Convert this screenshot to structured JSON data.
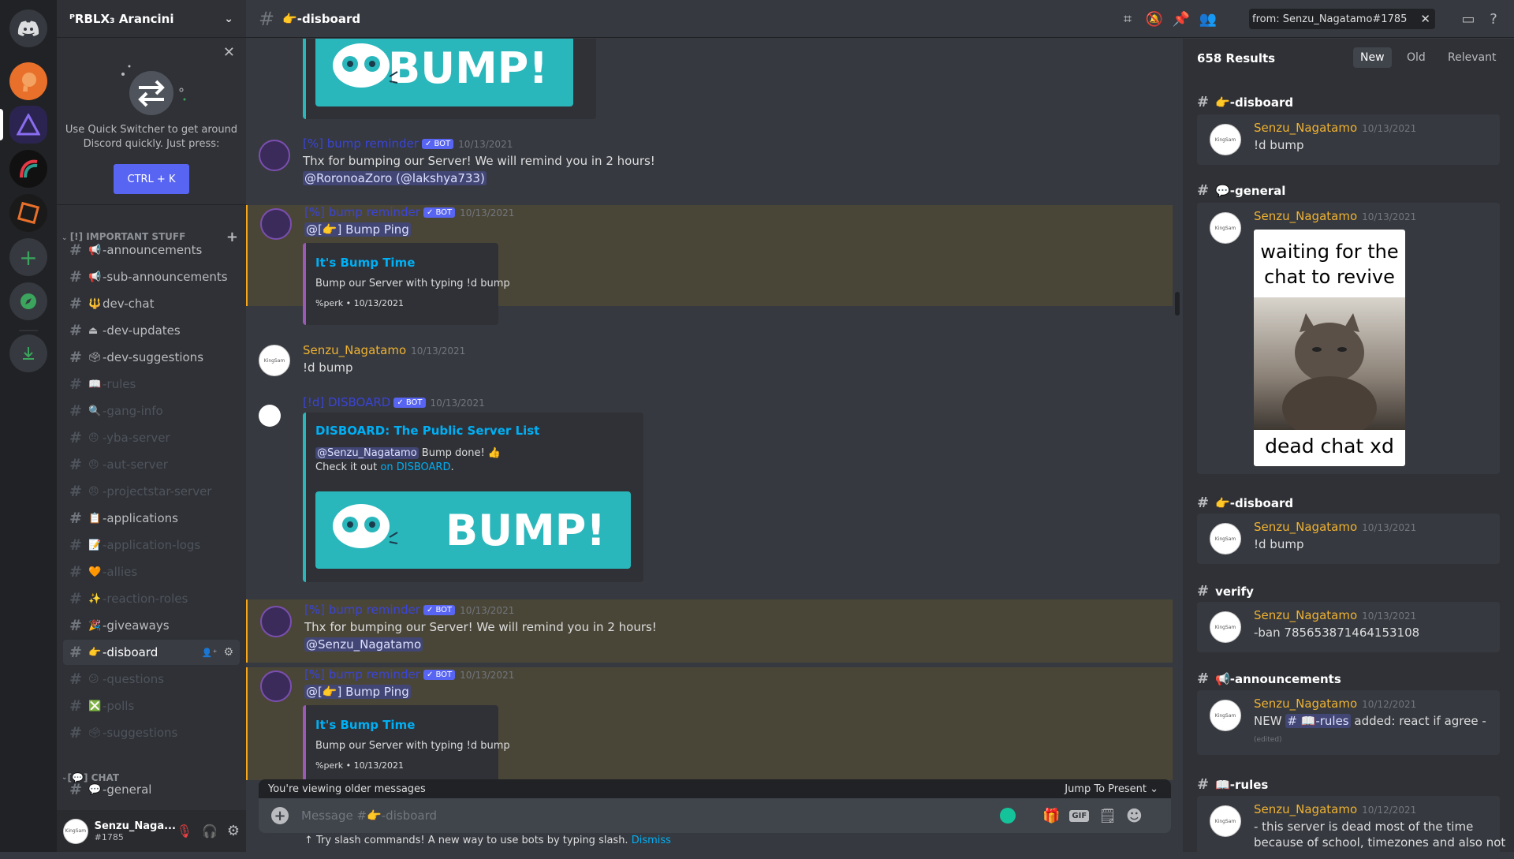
{
  "server": {
    "name": "ᴾRBLX₃ Arancini"
  },
  "quick_switcher": {
    "text": "Use Quick Switcher to get around Discord quickly. Just press:",
    "button": "CTRL + K"
  },
  "categories": [
    {
      "label": "[!] IMPORTANT STUFF"
    },
    {
      "label": "[💬] CHAT"
    }
  ],
  "channels": [
    {
      "icon": "📢",
      "name": "-announcements",
      "muted": false
    },
    {
      "icon": "📢",
      "name": "-sub-announcements",
      "muted": false
    },
    {
      "icon": "🔱",
      "name": "dev-chat",
      "muted": false
    },
    {
      "icon": "⏏",
      "name": "-dev-updates",
      "muted": false
    },
    {
      "icon": "🗳",
      "name": "-dev-suggestions",
      "muted": false
    },
    {
      "icon": "📖",
      "name": "-rules",
      "muted": true
    },
    {
      "icon": "🔍",
      "name": "-gang-info",
      "muted": true
    },
    {
      "icon": "😠",
      "name": "-yba-server",
      "muted": true
    },
    {
      "icon": "😠",
      "name": "-aut-server",
      "muted": true
    },
    {
      "icon": "😠",
      "name": "-projectstar-server",
      "muted": true
    },
    {
      "icon": "📋",
      "name": "-applications",
      "muted": false
    },
    {
      "icon": "📝",
      "name": "-application-logs",
      "muted": true
    },
    {
      "icon": "🧡",
      "name": "-allies",
      "muted": true
    },
    {
      "icon": "✨",
      "name": "-reaction-roles",
      "muted": true
    },
    {
      "icon": "🎉",
      "name": "-giveaways",
      "muted": false
    },
    {
      "icon": "👉",
      "name": "-disboard",
      "muted": false,
      "active": true
    },
    {
      "icon": "😕",
      "name": "-questions",
      "muted": true
    },
    {
      "icon": "❎",
      "name": "-polls",
      "muted": true
    },
    {
      "icon": "🗳",
      "name": "-suggestions",
      "muted": true
    },
    {
      "icon": "💬",
      "name": "-general",
      "muted": false
    }
  ],
  "user": {
    "name": "Senzu_Naga...",
    "tag": "#1785"
  },
  "topbar": {
    "channel": "👉-disboard",
    "search_query": "from: Senzu_Nagatamo#1785"
  },
  "messages": {
    "bump_reminder": "[%] bump reminder",
    "bot_tag": "✓ BOT",
    "date": "10/13/2021",
    "thx": "Thx for bumping our Server! We will remind you in 2 hours!",
    "mention_roronoa": "@RoronoaZoro (@lakshya733)",
    "bump_ping": "@[👉] Bump Ping",
    "embed_title": "It's Bump Time",
    "embed_body": "Bump our Server with typing !d bump",
    "embed_footer": "%perk • 10/13/2021",
    "senzu": "Senzu_Nagatamo",
    "d_bump": "!d bump",
    "disboard_bot": "[!d] DISBOARD",
    "disboard_title": "DISBOARD: The Public Server List",
    "mention_senzu": "@Senzu_Nagatamo",
    "bump_done": "Bump done! 👍",
    "check_it": "Check it out",
    "on_disboard": "on DISBOARD",
    "bump_word": "BUMP!",
    "avatar_text": "KingSam"
  },
  "composer": {
    "older": "You're viewing older messages",
    "jump": "Jump To Present",
    "placeholder": "Message #👉-disboard",
    "hint": "Try slash commands! A new way to use bots by typing slash.",
    "dismiss": "Dismiss"
  },
  "search": {
    "count": "658 Results",
    "sort_new": "New",
    "sort_old": "Old",
    "sort_relevant": "Relevant",
    "results": [
      {
        "channel": "👉-disboard",
        "author": "Senzu_Nagatamo",
        "date": "10/13/2021",
        "text": "!d bump"
      },
      {
        "channel": "💬-general",
        "author": "Senzu_Nagatamo",
        "date": "10/13/2021",
        "meme_top": "waiting for the chat to revive",
        "meme_bottom": "dead chat xd"
      },
      {
        "channel": "👉-disboard",
        "author": "Senzu_Nagatamo",
        "date": "10/13/2021",
        "text": "!d bump"
      },
      {
        "channel": "verify",
        "author": "Senzu_Nagatamo",
        "date": "10/13/2021",
        "text": "-ban 785653871464153108"
      },
      {
        "channel": "📢-announcements",
        "author": "Senzu_Nagatamo",
        "date": "10/12/2021",
        "text_pre": "NEW",
        "mention": "# 📖-rules",
        "text_post": "added: react if agree -",
        "edited": "(edited)"
      },
      {
        "channel": "📖-rules",
        "author": "Senzu_Nagatamo",
        "date": "10/12/2021",
        "text": "- this server is dead most of the time",
        "text2": "because of school, timezones and also not"
      }
    ]
  },
  "colors": {
    "accent": "#5865f2",
    "username": "#f0b232",
    "link": "#00aff4",
    "highlight": "#4a4637"
  }
}
